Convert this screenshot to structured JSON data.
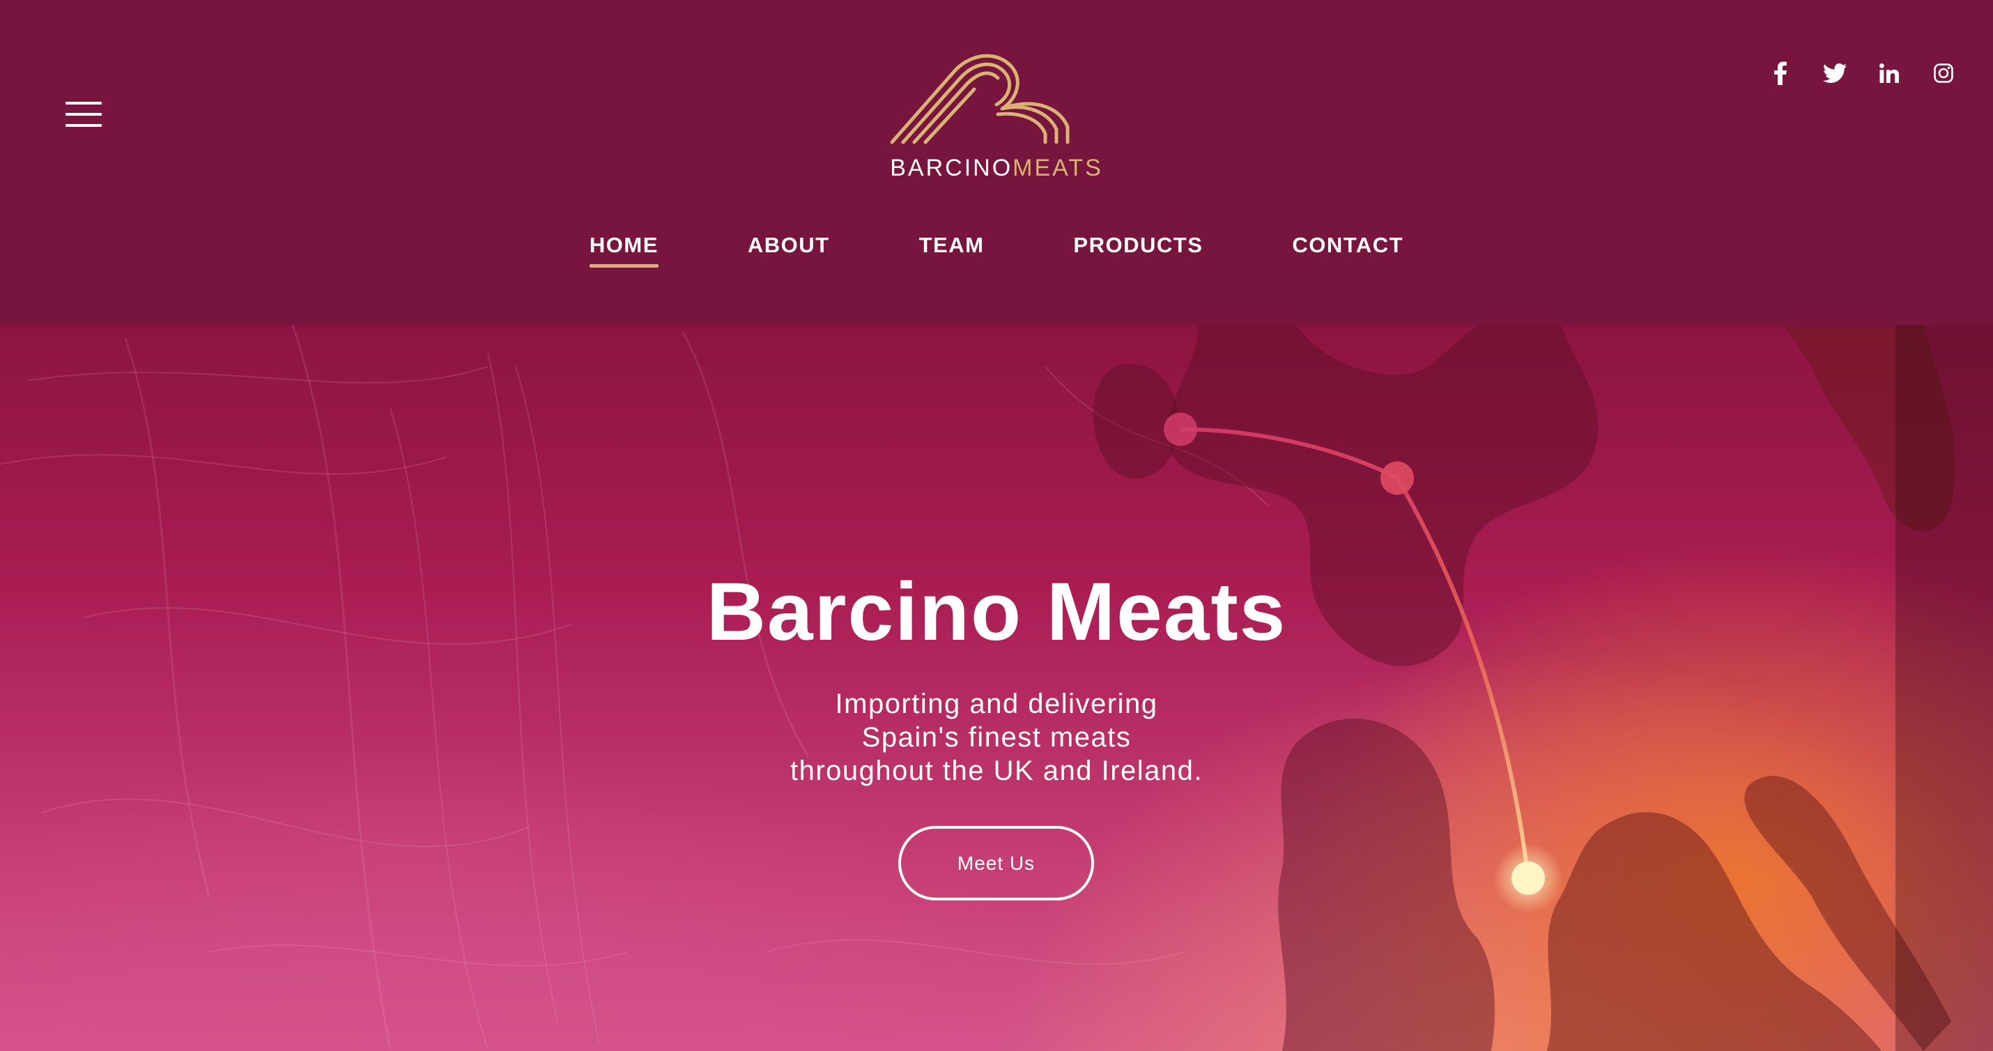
{
  "header": {
    "menu_icon": "hamburger-menu-icon",
    "logo": {
      "word1": "BARCINO",
      "word2": "MEATS",
      "mark_color": "#d9b274"
    },
    "social": [
      {
        "name": "facebook",
        "icon": "facebook-icon"
      },
      {
        "name": "twitter",
        "icon": "twitter-icon"
      },
      {
        "name": "linkedin",
        "icon": "linkedin-icon"
      },
      {
        "name": "instagram",
        "icon": "instagram-icon"
      }
    ],
    "nav": [
      {
        "label": "HOME",
        "active": true
      },
      {
        "label": "ABOUT",
        "active": false
      },
      {
        "label": "TEAM",
        "active": false
      },
      {
        "label": "PRODUCTS",
        "active": false
      },
      {
        "label": "CONTACT",
        "active": false
      }
    ]
  },
  "hero": {
    "title": "Barcino Meats",
    "subtitle_lines": [
      "Importing and delivering",
      "Spain's finest meats",
      "throughout the UK and Ireland."
    ],
    "button_label": "Meet Us"
  },
  "colors": {
    "header_bg": "#77153f",
    "accent_gold": "#d9b274",
    "hero_magenta": "#a81c52",
    "hero_orange": "#ee7828"
  }
}
